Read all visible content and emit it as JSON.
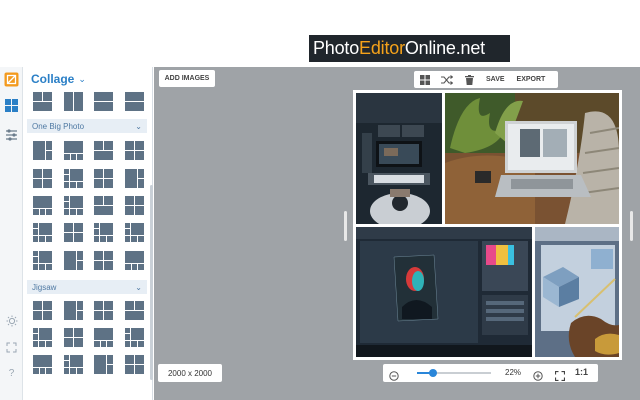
{
  "banner": {
    "part1": "Photo",
    "part2": "Editor",
    "part3": "Online.net",
    "accent_color": "#f5a21a",
    "bg_color": "#20262c"
  },
  "rail": {
    "icons": [
      "image-editor-icon",
      "collage-icon",
      "adjustments-icon",
      "light-icon",
      "fullscreen-icon",
      "help-icon"
    ]
  },
  "panel": {
    "title": "Collage",
    "sections": [
      {
        "label": "One Big Photo"
      },
      {
        "label": "Jigsaw"
      }
    ],
    "accent_color": "#2a7fc6"
  },
  "workspace": {
    "add_images_label": "ADD IMAGES",
    "toolbar": {
      "save_label": "SAVE",
      "export_label": "EXPORT"
    },
    "canvas_size": "2000 x 2000",
    "zoom": {
      "value_text": "22%",
      "fit_label": "1:1",
      "level": 0.22
    }
  },
  "photos": [
    {
      "name": "desk-setup-photo"
    },
    {
      "name": "laptop-on-couch-photo"
    },
    {
      "name": "photoshop-screen-photo"
    },
    {
      "name": "stylus-drawing-photo"
    }
  ]
}
